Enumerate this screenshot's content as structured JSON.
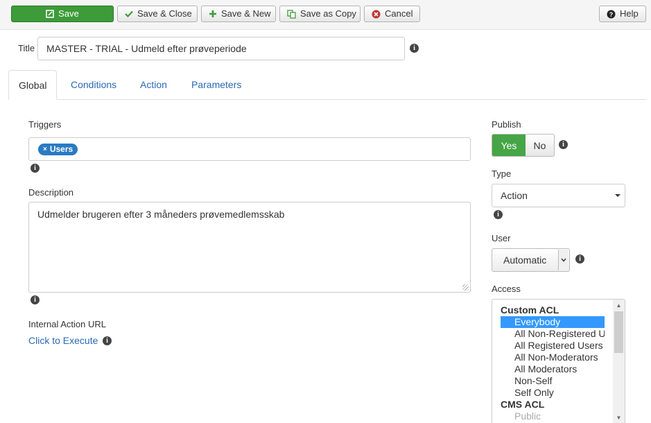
{
  "toolbar": {
    "save_label": "Save",
    "save_close_label": "Save & Close",
    "save_new_label": "Save & New",
    "save_copy_label": "Save as Copy",
    "cancel_label": "Cancel",
    "help_label": "Help"
  },
  "title": {
    "label": "Title",
    "value": "MASTER - TRIAL - Udmeld efter prøveperiode"
  },
  "tabs": [
    {
      "label": "Global",
      "active": true
    },
    {
      "label": "Conditions",
      "active": false
    },
    {
      "label": "Action",
      "active": false
    },
    {
      "label": "Parameters",
      "active": false
    }
  ],
  "triggers": {
    "label": "Triggers",
    "chips": [
      "Users"
    ]
  },
  "description": {
    "label": "Description",
    "value": "Udmelder brugeren efter 3 måneders prøvemedlemsskab"
  },
  "internal_url": {
    "label": "Internal Action URL",
    "link": "Click to Execute"
  },
  "publish": {
    "label": "Publish",
    "yes": "Yes",
    "no": "No",
    "selected": "Yes"
  },
  "type": {
    "label": "Type",
    "value": "Action"
  },
  "user": {
    "label": "User",
    "value": "Automatic"
  },
  "access": {
    "label": "Access",
    "groups": [
      {
        "label": "Custom ACL",
        "options": [
          "Everybody",
          "All Non-Registered Users",
          "All Registered Users",
          "All Non-Moderators",
          "All Moderators",
          "Non-Self",
          "Self Only"
        ]
      },
      {
        "label": "CMS ACL",
        "options": [
          "Public"
        ]
      }
    ],
    "selected": "Everybody"
  },
  "colors": {
    "save_green": "#3d9b39",
    "yes_green": "#46a546",
    "link_blue": "#2a69b8",
    "chip_blue": "#2a7ac2",
    "selected_blue": "#3399ff"
  }
}
